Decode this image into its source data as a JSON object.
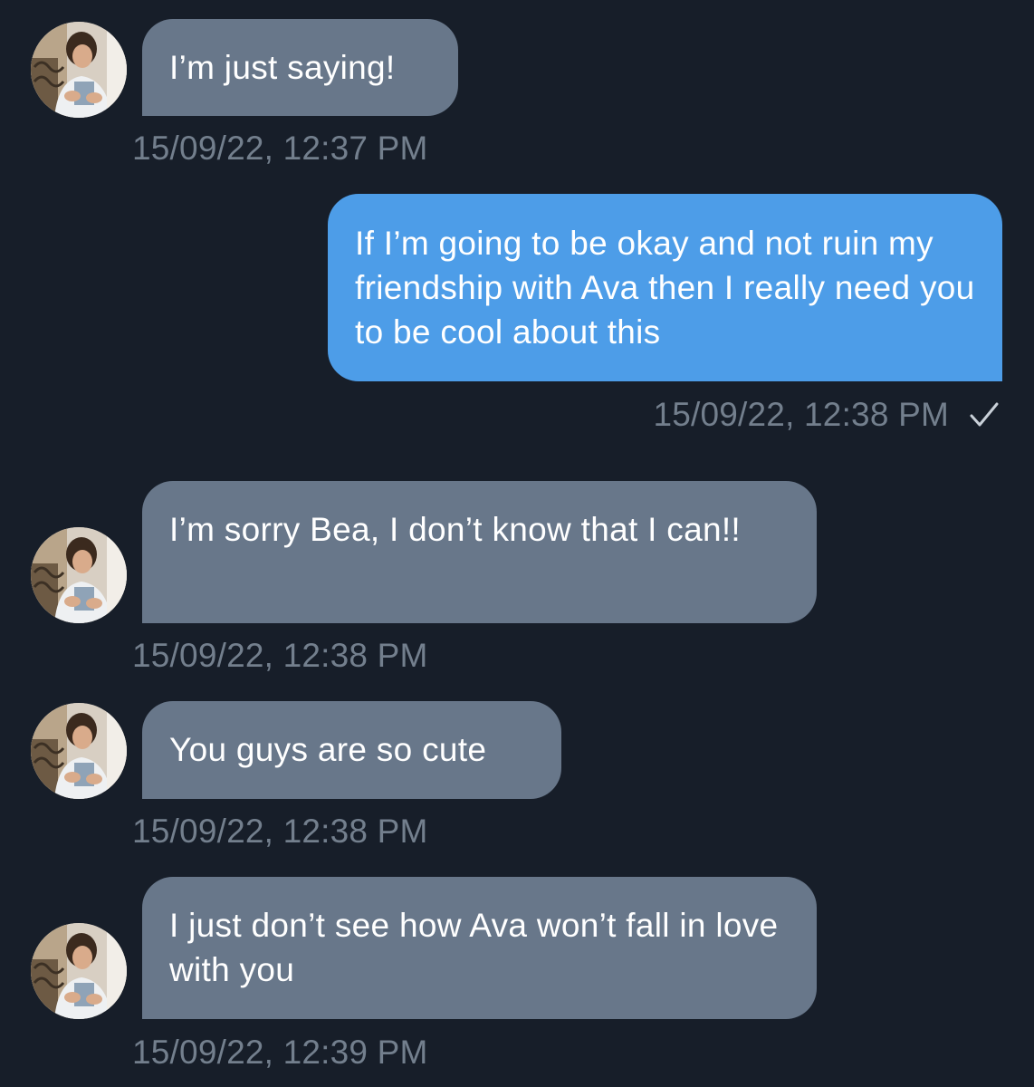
{
  "messages": [
    {
      "direction": "incoming",
      "text": "I’m just saying!",
      "timestamp": "15/09/22, 12:37 PM"
    },
    {
      "direction": "outgoing",
      "text": "If I’m going to be okay and not ruin my friendship with Ava then I really need you to be cool about this",
      "timestamp": "15/09/22, 12:38 PM",
      "status_icon": "read-check-icon"
    },
    {
      "direction": "incoming",
      "text": "I’m sorry Bea, I don’t know that I can!!",
      "timestamp": "15/09/22, 12:38 PM"
    },
    {
      "direction": "incoming",
      "text": "You guys are so cute",
      "timestamp": "15/09/22, 12:38 PM"
    },
    {
      "direction": "incoming",
      "text": "I just don’t see how Ava won’t fall in love with you",
      "timestamp": "15/09/22, 12:39 PM"
    }
  ],
  "colors": {
    "background": "#171e29",
    "incoming_bubble": "#68778a",
    "outgoing_bubble": "#4d9de8",
    "timestamp": "#737f8d"
  }
}
